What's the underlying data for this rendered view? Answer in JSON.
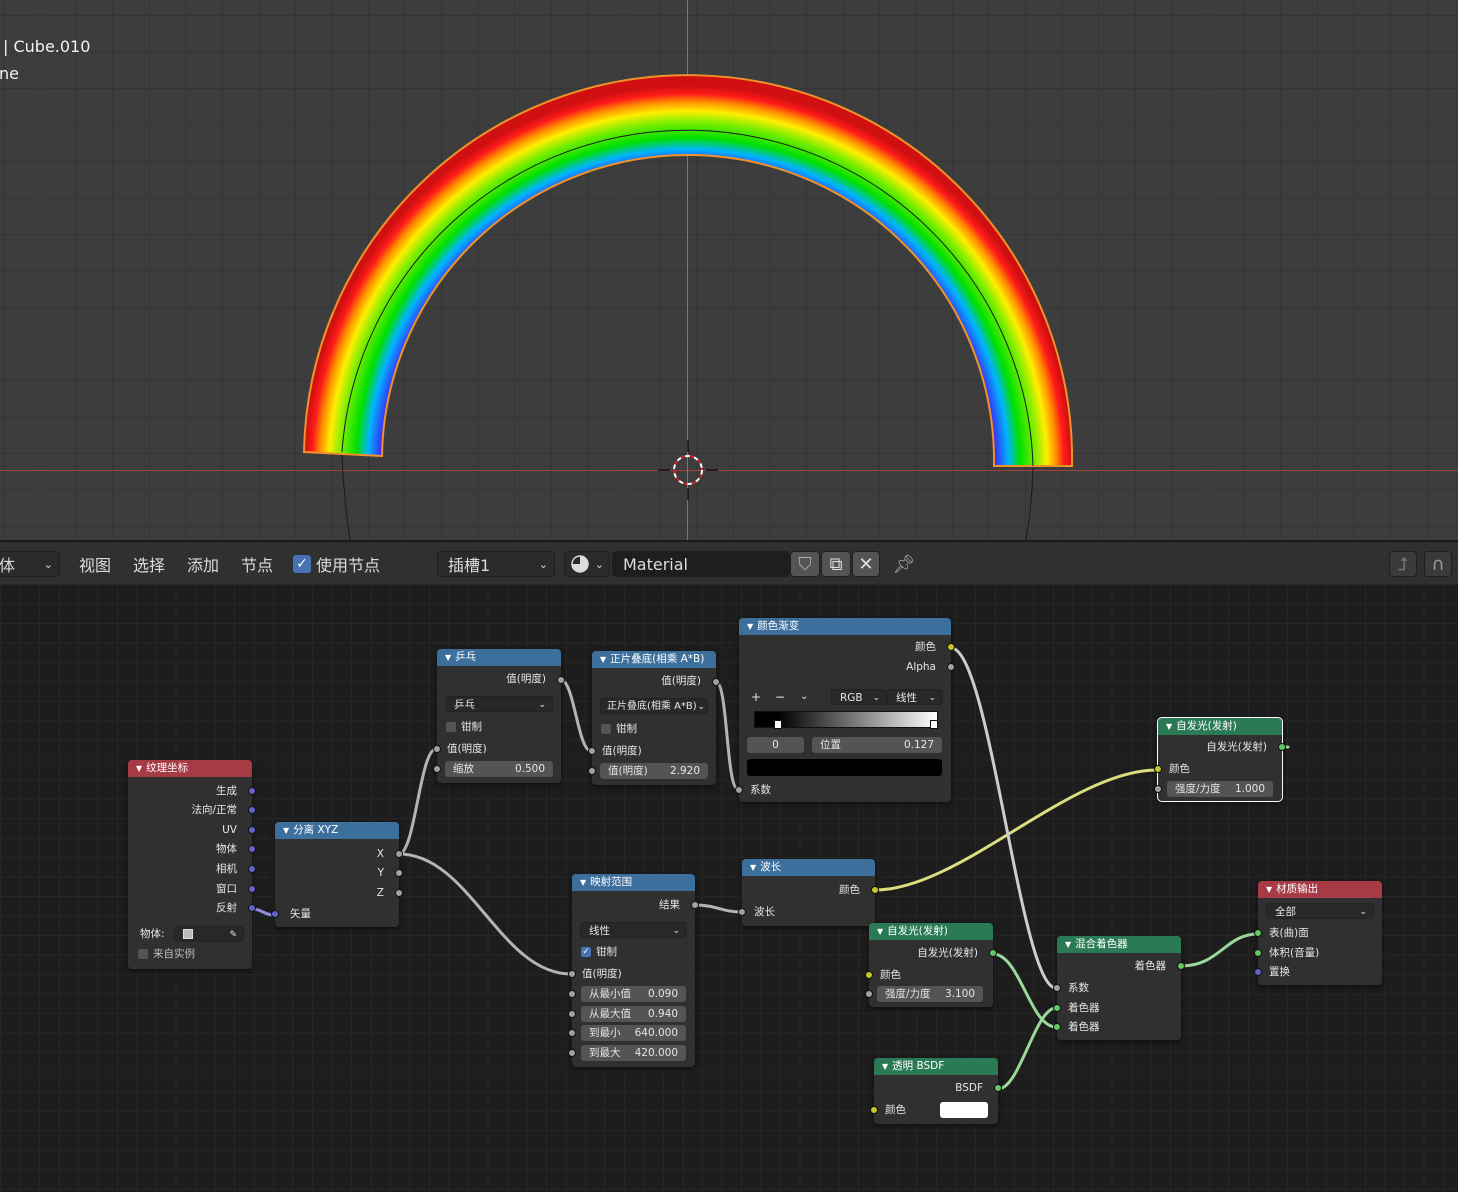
{
  "viewport": {
    "object_label": "| Cube.010",
    "object_sub": "ne"
  },
  "header": {
    "editor_type_label": "体",
    "menu": [
      "视图",
      "选择",
      "添加",
      "节点"
    ],
    "use_nodes_label": "使用节点",
    "use_nodes_checked": true,
    "slot_label": "插槽1",
    "material_name": "Material"
  },
  "nodes": {
    "texcoord": {
      "title": "纹理坐标",
      "outputs": [
        "生成",
        "法向/正常",
        "UV",
        "物体",
        "相机",
        "窗口",
        "反射"
      ],
      "object_label": "物体:",
      "from_instancer": "来自实例"
    },
    "separate": {
      "title": "分离 XYZ",
      "outputs": [
        "X",
        "Y",
        "Z"
      ],
      "input": "矢量"
    },
    "pingpong": {
      "title": "乒乓",
      "output": "值(明度)",
      "operation": "乒乓",
      "clamp": "钳制",
      "input": "值(明度)",
      "scale_label": "缩放",
      "scale_value": "0.500"
    },
    "multiply": {
      "title": "正片叠底(相乘 A*B)",
      "output": "值(明度)",
      "operation": "正片叠底(相乘 A*B)",
      "clamp": "钳制",
      "input": "值(明度)",
      "value_label": "值(明度)",
      "value_value": "2.920"
    },
    "colorramp": {
      "title": "颜色渐变",
      "output_color": "颜色",
      "output_alpha": "Alpha",
      "plus": "+",
      "minus": "−",
      "mode": "RGB",
      "interp": "线性",
      "index": "0",
      "pos_label": "位置",
      "pos_value": "0.127",
      "input": "系数"
    },
    "maprange": {
      "title": "映射范围",
      "output": "结果",
      "interp": "线性",
      "clamp": "钳制",
      "input": "值(明度)",
      "fields": [
        {
          "label": "从最小值",
          "value": "0.090"
        },
        {
          "label": "从最大值",
          "value": "0.940"
        },
        {
          "label": "到最小",
          "value": "640.000"
        },
        {
          "label": "到最大",
          "value": "420.000"
        }
      ]
    },
    "wavelength": {
      "title": "波长",
      "output": "颜色",
      "input": "波长"
    },
    "emission1": {
      "title": "自发光(发射)",
      "output": "自发光(发射)",
      "color": "颜色",
      "strength_label": "强度/力度",
      "strength_value": "1.000"
    },
    "emission2": {
      "title": "自发光(发射)",
      "output": "自发光(发射)",
      "color": "颜色",
      "strength_label": "强度/力度",
      "strength_value": "3.100"
    },
    "mix": {
      "title": "混合着色器",
      "output": "着色器",
      "fac": "系数",
      "shader1": "着色器",
      "shader2": "着色器"
    },
    "transparent": {
      "title": "透明 BSDF",
      "output": "BSDF",
      "color": "颜色"
    },
    "output": {
      "title": "材质输出",
      "target": "全部",
      "surface": "表(曲)面",
      "volume": "体积(音量)",
      "displacement": "置换"
    }
  }
}
